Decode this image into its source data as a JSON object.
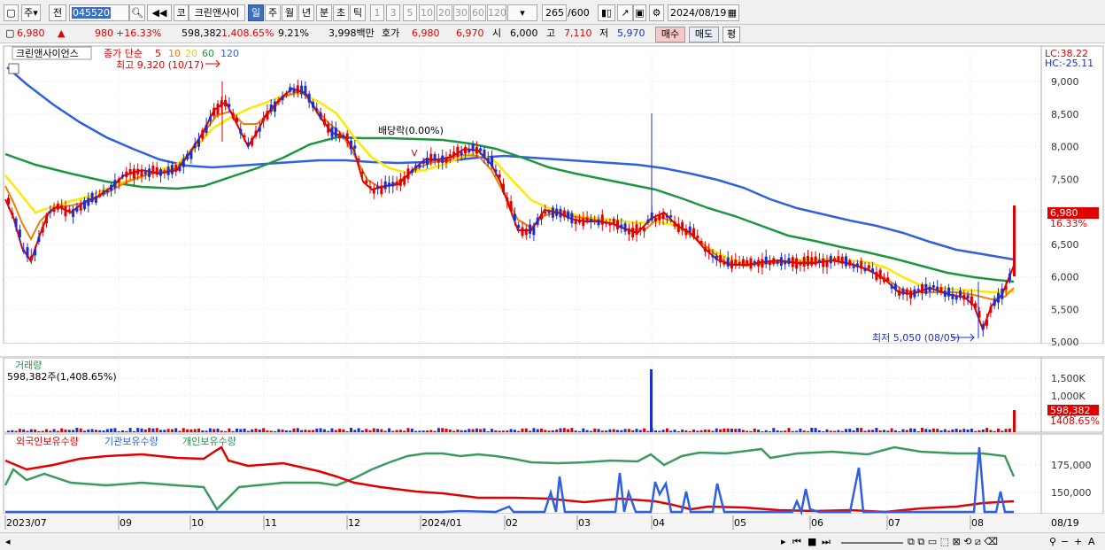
{
  "toolbar": {
    "period_prefix": "주",
    "prev": "전",
    "code": "045520",
    "name_short": "코",
    "company": "크린앤사이",
    "periods": [
      "일",
      "주",
      "월",
      "년",
      "분",
      "초",
      "틱"
    ],
    "selected_period": "일",
    "intervals": [
      "1",
      "3",
      "5",
      "10",
      "20",
      "30",
      "60",
      "120"
    ],
    "count": "265",
    "total": "/600",
    "date": "2024/08/19"
  },
  "quote": {
    "price": "6,980",
    "arrow": "▲",
    "change": "980",
    "change_pct": "+16.33%",
    "volume": "598,382",
    "volume_pct": "1,408.65%",
    "turnover": "9.21%",
    "amount": "3,998백만",
    "ask_label": "호가",
    "ask": "6,980",
    "bid": "6,970",
    "open_label": "시",
    "open": "6,000",
    "high_label": "고",
    "high": "7,110",
    "low_label": "저",
    "low": "5,970",
    "buy": "매수",
    "sell": "매도",
    "avg": "평"
  },
  "price_panel": {
    "name": "크린앤사이언스",
    "ma_title": "종가 단순",
    "ma_periods": [
      "5",
      "10",
      "20",
      "60",
      "120"
    ],
    "max_label": "최고 9,320 (10/17)",
    "min_label": "최저 5,050 (08/05)",
    "dividend_label": "배당락(0.00%)",
    "lc": "LC:38.22",
    "hc": "HC:-25.11",
    "y_ticks": [
      "9,000",
      "8,500",
      "8,000",
      "7,500",
      "7,000",
      "6,500",
      "6,000",
      "5,500",
      "5,000"
    ],
    "current_price": "6,980",
    "current_pct": "16.33%"
  },
  "volume_panel": {
    "title": "거래량",
    "subtitle": "598,382주(1,408.65%)",
    "y_ticks": [
      "1,500K",
      "1,000K",
      "500K"
    ],
    "current": "598,382",
    "current_pct": "1408.65%"
  },
  "holding_panel": {
    "foreign": "외국인보유수량",
    "institution": "기관보유수량",
    "individual": "개인보유수량",
    "y_ticks": [
      "175,000",
      "150,000"
    ]
  },
  "x_labels": [
    "2023/07",
    "09",
    "10",
    "11",
    "12",
    "2024/01",
    "02",
    "03",
    "04",
    "05",
    "06",
    "07",
    "08"
  ],
  "x_end": "08/19",
  "colors": {
    "up": "#e00000",
    "down": "#1a2fd0",
    "ma5": "#e00000",
    "ma10": "#f08000",
    "ma20": "#ffe800",
    "ma60": "#1e9640",
    "ma120": "#3060e0",
    "foreign": "#e00000",
    "institution": "#3060e0",
    "individual": "#3c9a60"
  },
  "chart_data": {
    "type": "candlestick",
    "series": [
      {
        "name": "주가",
        "x": [
          "2023/07",
          "09",
          "10",
          "10/17",
          "11",
          "12",
          "2024/01",
          "02",
          "03",
          "04",
          "05",
          "06",
          "07",
          "08/05",
          "08/19"
        ],
        "y": [
          7200,
          7600,
          8000,
          9320,
          8700,
          8000,
          7800,
          7900,
          6800,
          6800,
          6300,
          6300,
          5900,
          5050,
          6980
        ]
      }
    ]
  }
}
